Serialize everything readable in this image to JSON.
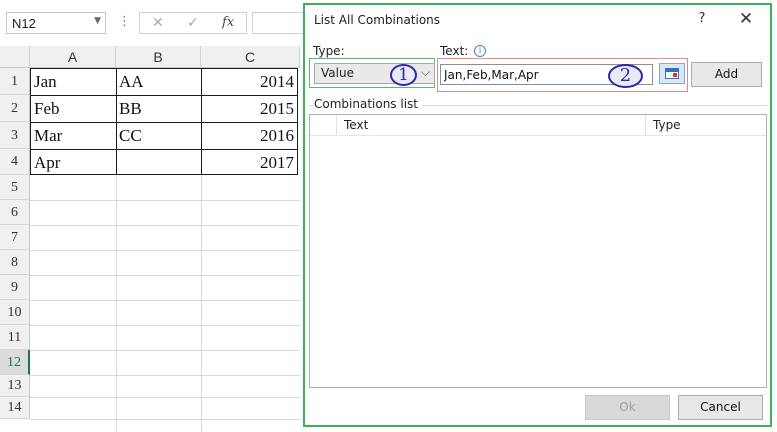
{
  "formula_bar": {
    "name_box": "N12",
    "cancel_symbol": "✕",
    "enter_symbol": "✓",
    "function_symbol": "fx"
  },
  "sheet": {
    "columns": [
      "A",
      "B",
      "C"
    ],
    "rows": [
      "1",
      "2",
      "3",
      "4",
      "5",
      "6",
      "7",
      "8",
      "9",
      "10",
      "11",
      "12",
      "13",
      "14"
    ],
    "active_row": "12",
    "cells": {
      "A1": "Jan",
      "B1": "AA",
      "C1": "2014",
      "A2": "Feb",
      "B2": "BB",
      "C2": "2015",
      "A3": "Mar",
      "B3": "CC",
      "C3": "2016",
      "A4": "Apr",
      "B4": "",
      "C4": "2017"
    }
  },
  "dialog": {
    "title": "List All Combinations",
    "help": "?",
    "close": "✕",
    "type_label": "Type:",
    "type_value": "Value",
    "text_label": "Text:",
    "text_value": "Jan,Feb,Mar,Apr",
    "add_label": "Add",
    "list_label": "Combinations list",
    "list_columns": [
      "Text",
      "Type"
    ],
    "ok_label": "Ok",
    "cancel_label": "Cancel",
    "step_badges": [
      "1",
      "2"
    ],
    "colors": {
      "dialog_border": "#3fb05a",
      "type_highlight": "#5ab86c",
      "text_highlight": "#e38a8a",
      "badge": "#2a2aa6"
    }
  }
}
